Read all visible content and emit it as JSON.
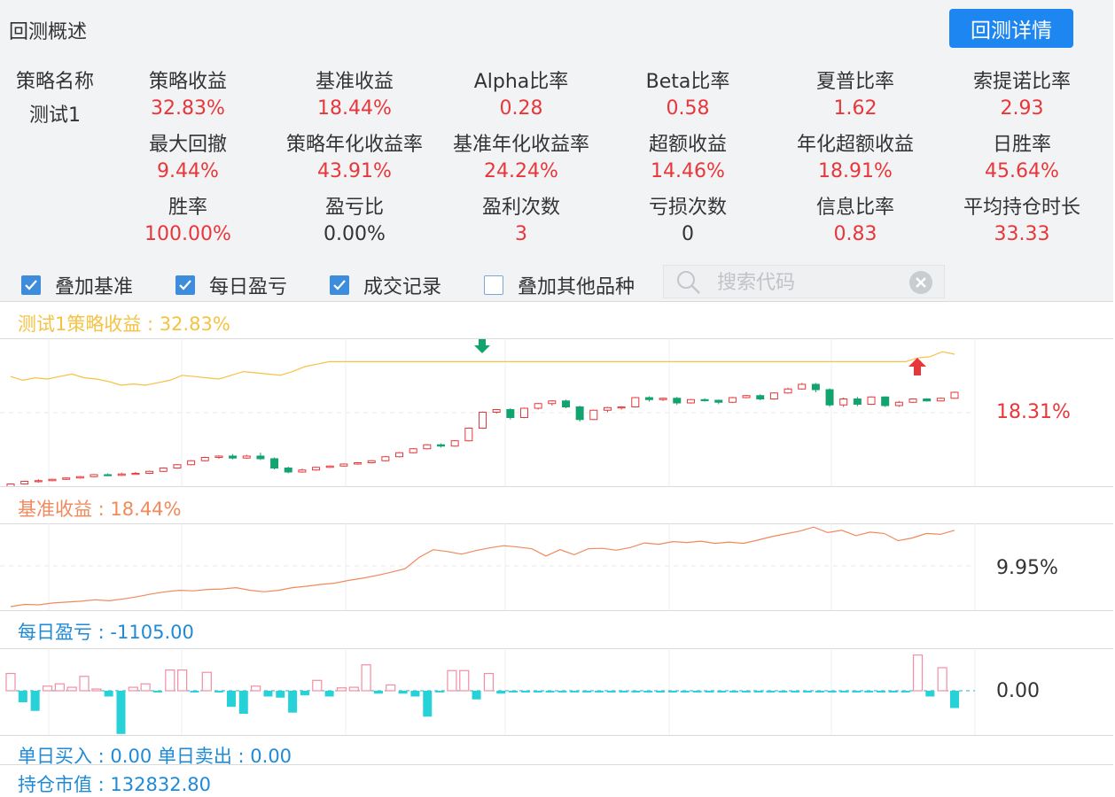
{
  "header": {
    "title": "回测概述",
    "detail_button": "回测详情"
  },
  "strategy": {
    "name_label": "策略名称",
    "name_value": "测试1"
  },
  "stats": [
    [
      {
        "label": "策略收益",
        "value": "32.83%",
        "color": "red"
      },
      {
        "label": "基准收益",
        "value": "18.44%",
        "color": "red"
      },
      {
        "label": "Alpha比率",
        "value": "0.28",
        "color": "red"
      },
      {
        "label": "Beta比率",
        "value": "0.58",
        "color": "red"
      },
      {
        "label": "夏普比率",
        "value": "1.62",
        "color": "red"
      },
      {
        "label": "索提诺比率",
        "value": "2.93",
        "color": "red"
      }
    ],
    [
      {
        "label": "最大回撤",
        "value": "9.44%",
        "color": "red"
      },
      {
        "label": "策略年化收益率",
        "value": "43.91%",
        "color": "red"
      },
      {
        "label": "基准年化收益率",
        "value": "24.24%",
        "color": "red"
      },
      {
        "label": "超额收益",
        "value": "14.46%",
        "color": "red"
      },
      {
        "label": "年化超额收益",
        "value": "18.91%",
        "color": "red"
      },
      {
        "label": "日胜率",
        "value": "45.64%",
        "color": "red"
      }
    ],
    [
      {
        "label": "胜率",
        "value": "100.00%",
        "color": "red"
      },
      {
        "label": "盈亏比",
        "value": "0.00%",
        "color": "dark"
      },
      {
        "label": "盈利次数",
        "value": "3",
        "color": "red"
      },
      {
        "label": "亏损次数",
        "value": "0",
        "color": "dark"
      },
      {
        "label": "信息比率",
        "value": "0.83",
        "color": "red"
      },
      {
        "label": "平均持仓时长",
        "value": "33.33",
        "color": "red"
      }
    ]
  ],
  "options": [
    {
      "label": "叠加基准",
      "checked": true
    },
    {
      "label": "每日盈亏",
      "checked": true
    },
    {
      "label": "成交记录",
      "checked": true
    },
    {
      "label": "叠加其他品种",
      "checked": false
    }
  ],
  "search": {
    "placeholder": "搜索代码"
  },
  "panels": {
    "strategy": {
      "label": "测试1策略收益 : 32.83%",
      "right_value": "18.31%",
      "color": "#f5c242"
    },
    "benchmark": {
      "label": "基准收益 : 18.44%",
      "right_value": "9.95%",
      "color": "#f08a5d"
    },
    "daily_pnl": {
      "label": "每日盈亏 : -1105.00",
      "right_value": "0.00",
      "color": "#1f8ad6"
    },
    "trade_info": {
      "label": "单日买入 : 0.00  单日卖出 : 0.00",
      "color": "#1f8ad6"
    },
    "position": {
      "label": "持仓市值 : 132832.80",
      "color": "#1f8ad6"
    }
  },
  "colors": {
    "up": "#e8373a",
    "down": "#13a36f",
    "accent": "#1e86f0",
    "cyan": "#27d1d8"
  },
  "chart_data": [
    {
      "type": "line",
      "series": [
        {
          "name": "测试1策略收益",
          "values": [
            12,
            9,
            11,
            10,
            12,
            14,
            11,
            10,
            8,
            5,
            6,
            5,
            7,
            9,
            13,
            12,
            11,
            10,
            13,
            16,
            15,
            14,
            13,
            16,
            20,
            22,
            24,
            24,
            24,
            24,
            24,
            24,
            24,
            24,
            24,
            24,
            24,
            24,
            24,
            24,
            24,
            24,
            24,
            24,
            24,
            24,
            24,
            24,
            24,
            24,
            24,
            24,
            24,
            24,
            24,
            24,
            24,
            24,
            24,
            24,
            24,
            24,
            24,
            24,
            24,
            24,
            24,
            24,
            24,
            24,
            24,
            24,
            24,
            24,
            27,
            28,
            32,
            30
          ]
        }
      ]
    },
    {
      "type": "candlestick",
      "values": [
        [
          -1,
          -0.6,
          -1.2,
          -0.5
        ],
        [
          -0.6,
          -0.2,
          -0.7,
          -0.1
        ],
        [
          -0.2,
          -0.1,
          -0.4,
          0.1
        ],
        [
          -0.1,
          0.1,
          -0.2,
          0.2
        ],
        [
          0.1,
          0.3,
          0,
          0.4
        ],
        [
          0.3,
          0.5,
          0.2,
          0.6
        ],
        [
          0.5,
          0.8,
          0.4,
          0.9
        ],
        [
          0.8,
          0.7,
          0.6,
          1
        ],
        [
          0.7,
          0.9,
          0.6,
          1.1
        ],
        [
          0.9,
          1.0,
          0.8,
          1.2
        ],
        [
          1.0,
          1.3,
          0.9,
          1.4
        ],
        [
          1.3,
          1.8,
          1.2,
          1.9
        ],
        [
          1.8,
          2.3,
          1.7,
          2.4
        ],
        [
          2.3,
          2.9,
          2.2,
          3.0
        ],
        [
          2.9,
          3.4,
          2.8,
          3.5
        ],
        [
          3.4,
          3.6,
          3.2,
          3.7
        ],
        [
          3.6,
          3.3,
          3.1,
          3.9
        ],
        [
          3.3,
          3.6,
          3.2,
          3.8
        ],
        [
          3.6,
          3.2,
          3.0,
          4.1
        ],
        [
          3.2,
          1.8,
          1.6,
          3.4
        ],
        [
          1.8,
          1.2,
          1.0,
          2.0
        ],
        [
          1.2,
          1.5,
          1.1,
          1.7
        ],
        [
          1.5,
          1.9,
          1.4,
          2.0
        ],
        [
          1.9,
          2.1,
          1.8,
          2.2
        ],
        [
          2.1,
          2.4,
          2.0,
          2.5
        ],
        [
          2.4,
          2.6,
          2.3,
          2.7
        ],
        [
          2.6,
          2.9,
          2.5,
          3.0
        ],
        [
          2.9,
          3.5,
          2.8,
          3.6
        ],
        [
          3.5,
          4.1,
          3.4,
          4.2
        ],
        [
          4.1,
          4.7,
          4.0,
          4.8
        ],
        [
          4.7,
          5.3,
          4.6,
          5.4
        ],
        [
          5.3,
          5.1,
          4.9,
          5.5
        ],
        [
          5.1,
          5.9,
          5.0,
          6.0
        ],
        [
          5.9,
          7.8,
          5.8,
          7.9
        ],
        [
          7.8,
          10.2,
          7.7,
          10.3
        ],
        [
          10.2,
          10.6,
          10.0,
          10.7
        ],
        [
          10.6,
          9.4,
          9.1,
          10.8
        ],
        [
          9.4,
          10.8,
          9.3,
          10.9
        ],
        [
          10.8,
          11.5,
          10.6,
          11.6
        ],
        [
          11.5,
          11.9,
          11.2,
          12.0
        ],
        [
          11.9,
          11.0,
          10.8,
          12.1
        ],
        [
          11.0,
          9.1,
          8.8,
          11.2
        ],
        [
          9.1,
          10.5,
          9.0,
          10.6
        ],
        [
          10.5,
          10.9,
          10.2,
          11.0
        ],
        [
          10.9,
          11.0,
          10.6,
          11.1
        ],
        [
          11.0,
          12.4,
          10.9,
          12.5
        ],
        [
          12.4,
          12.1,
          11.8,
          12.6
        ],
        [
          12.1,
          12.3,
          11.9,
          12.4
        ],
        [
          12.3,
          11.6,
          11.3,
          12.5
        ],
        [
          11.6,
          12.1,
          11.5,
          12.2
        ],
        [
          12.1,
          12.0,
          11.8,
          12.3
        ],
        [
          12.0,
          11.7,
          11.4,
          12.1
        ],
        [
          11.7,
          12.4,
          11.6,
          12.5
        ],
        [
          12.4,
          12.7,
          12.3,
          12.8
        ],
        [
          12.7,
          12.2,
          12.0,
          12.9
        ],
        [
          12.2,
          13.1,
          12.1,
          13.2
        ],
        [
          13.1,
          13.7,
          13.0,
          13.9
        ],
        [
          13.7,
          14.4,
          13.6,
          14.6
        ],
        [
          14.4,
          13.6,
          13.2,
          14.6
        ],
        [
          13.6,
          11.3,
          11.0,
          13.8
        ],
        [
          11.3,
          12.2,
          11.0,
          12.4
        ],
        [
          12.2,
          11.4,
          11.1,
          12.5
        ],
        [
          11.4,
          12.5,
          11.3,
          12.6
        ],
        [
          12.5,
          11.2,
          11.0,
          12.6
        ],
        [
          11.2,
          11.7,
          11.0,
          11.9
        ],
        [
          11.7,
          12.2,
          11.6,
          12.3
        ],
        [
          12.2,
          11.9,
          11.8,
          12.3
        ],
        [
          11.9,
          12.3,
          11.8,
          12.4
        ],
        [
          12.3,
          13.2,
          12.2,
          13.3
        ]
      ]
    },
    {
      "type": "line",
      "series": [
        {
          "name": "基准收益",
          "values": [
            0,
            0.5,
            0.4,
            0.8,
            1,
            1.2,
            1.5,
            1.3,
            1.7,
            2.2,
            2.8,
            3.3,
            3.6,
            3.5,
            3.8,
            3.9,
            4.2,
            3.6,
            3.3,
            3.6,
            4.2,
            4.5,
            4.9,
            5.2,
            5.8,
            6.3,
            6.9,
            7.6,
            8.4,
            10.9,
            12.6,
            12.2,
            11.6,
            12.4,
            13.0,
            13.5,
            13.2,
            12.8,
            11.2,
            12.6,
            11.5,
            12.8,
            12.9,
            12.5,
            13.1,
            14.1,
            13.8,
            14.4,
            14.2,
            14.5,
            14.0,
            14.3,
            14.0,
            14.7,
            15.5,
            16.1,
            16.7,
            17.6,
            16.4,
            16.9,
            15.7,
            16.5,
            16.2,
            14.6,
            15.2,
            16.2,
            16.0,
            16.9
          ]
        }
      ]
    },
    {
      "type": "bar",
      "values": [
        30,
        -20,
        -35,
        8,
        12,
        6,
        25,
        3,
        -10,
        -75,
        6,
        12,
        -3,
        36,
        36,
        -3,
        32,
        -3,
        -28,
        -40,
        8,
        -10,
        -12,
        -38,
        -8,
        18,
        -10,
        5,
        6,
        45,
        -5,
        10,
        -5,
        -10,
        -45,
        -3,
        35,
        35,
        -15,
        30,
        -5,
        -3,
        -3,
        -3,
        -3,
        -3,
        -3,
        -3,
        -3,
        -3,
        -3,
        -3,
        -3,
        -3,
        -3,
        -3,
        -3,
        -3,
        -3,
        -3,
        -3,
        -3,
        -3,
        -3,
        -3,
        -3,
        -3,
        -3,
        -3,
        -3,
        -3,
        -3,
        -3,
        -3,
        62,
        -10,
        40,
        -30
      ]
    }
  ]
}
